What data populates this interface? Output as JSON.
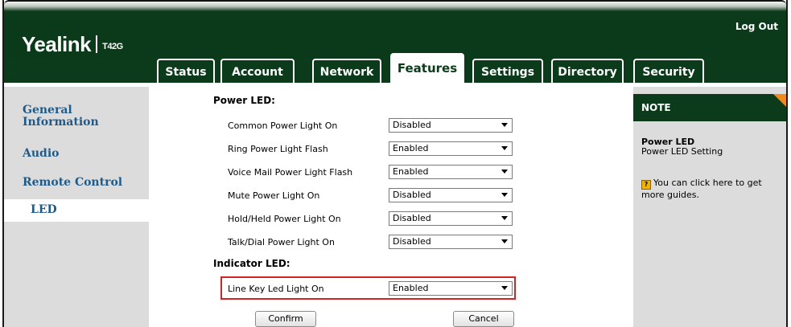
{
  "header": {
    "logo": "Yealink",
    "model": "T42G",
    "logout": "Log Out"
  },
  "tabs": [
    {
      "label": "Status",
      "active": false
    },
    {
      "label": "Account",
      "active": false
    },
    {
      "label": "Network",
      "active": false
    },
    {
      "label": "Features",
      "active": true
    },
    {
      "label": "Settings",
      "active": false
    },
    {
      "label": "Directory",
      "active": false
    },
    {
      "label": "Security",
      "active": false
    }
  ],
  "sidebar": {
    "items": [
      {
        "label": "General Information",
        "active": false
      },
      {
        "label": "Audio",
        "active": false
      },
      {
        "label": "Remote Control",
        "active": false
      },
      {
        "label": "LED",
        "active": true
      }
    ]
  },
  "content": {
    "power_section": "Power LED:",
    "power_rows": [
      {
        "label": "Common Power Light On",
        "value": "Disabled"
      },
      {
        "label": "Ring Power Light Flash",
        "value": "Enabled"
      },
      {
        "label": "Voice Mail Power Light Flash",
        "value": "Enabled"
      },
      {
        "label": "Mute Power Light On",
        "value": "Disabled"
      },
      {
        "label": "Hold/Held Power Light On",
        "value": "Disabled"
      },
      {
        "label": "Talk/Dial Power Light On",
        "value": "Disabled"
      }
    ],
    "indicator_section": "Indicator LED:",
    "indicator_rows": [
      {
        "label": "Line Key Led Light On",
        "value": "Enabled"
      }
    ],
    "confirm_label": "Confirm",
    "cancel_label": "Cancel"
  },
  "note": {
    "title": "NOTE",
    "heading": "Power LED",
    "text": "Power LED Setting",
    "guide": "You can click here to get more guides."
  },
  "colors": {
    "header_green": "#0b3b1a",
    "link_blue": "#1e5b8b",
    "highlight_red": "#d42323",
    "note_accent": "#f08a1c"
  }
}
